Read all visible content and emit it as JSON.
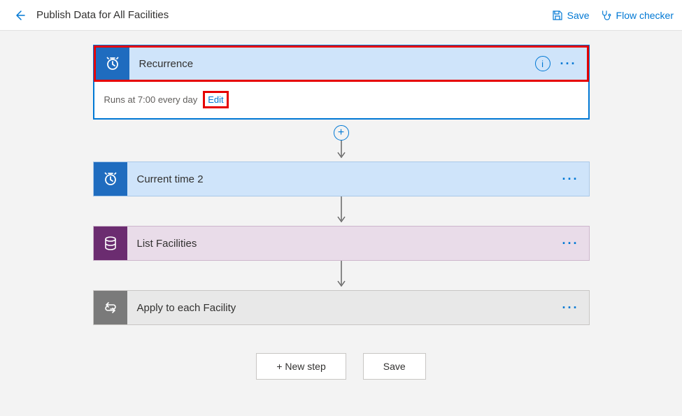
{
  "header": {
    "title": "Publish Data for All Facilities",
    "actions": {
      "save": "Save",
      "flow_checker": "Flow checker"
    }
  },
  "steps": {
    "recurrence": {
      "label": "Recurrence",
      "runs_text": "Runs at 7:00 every day",
      "edit_label": "Edit"
    },
    "current_time": {
      "label": "Current time 2"
    },
    "list_facilities": {
      "label": "List Facilities"
    },
    "apply_each": {
      "label": "Apply to each Facility"
    }
  },
  "buttons": {
    "new_step": "+ New step",
    "save": "Save"
  }
}
